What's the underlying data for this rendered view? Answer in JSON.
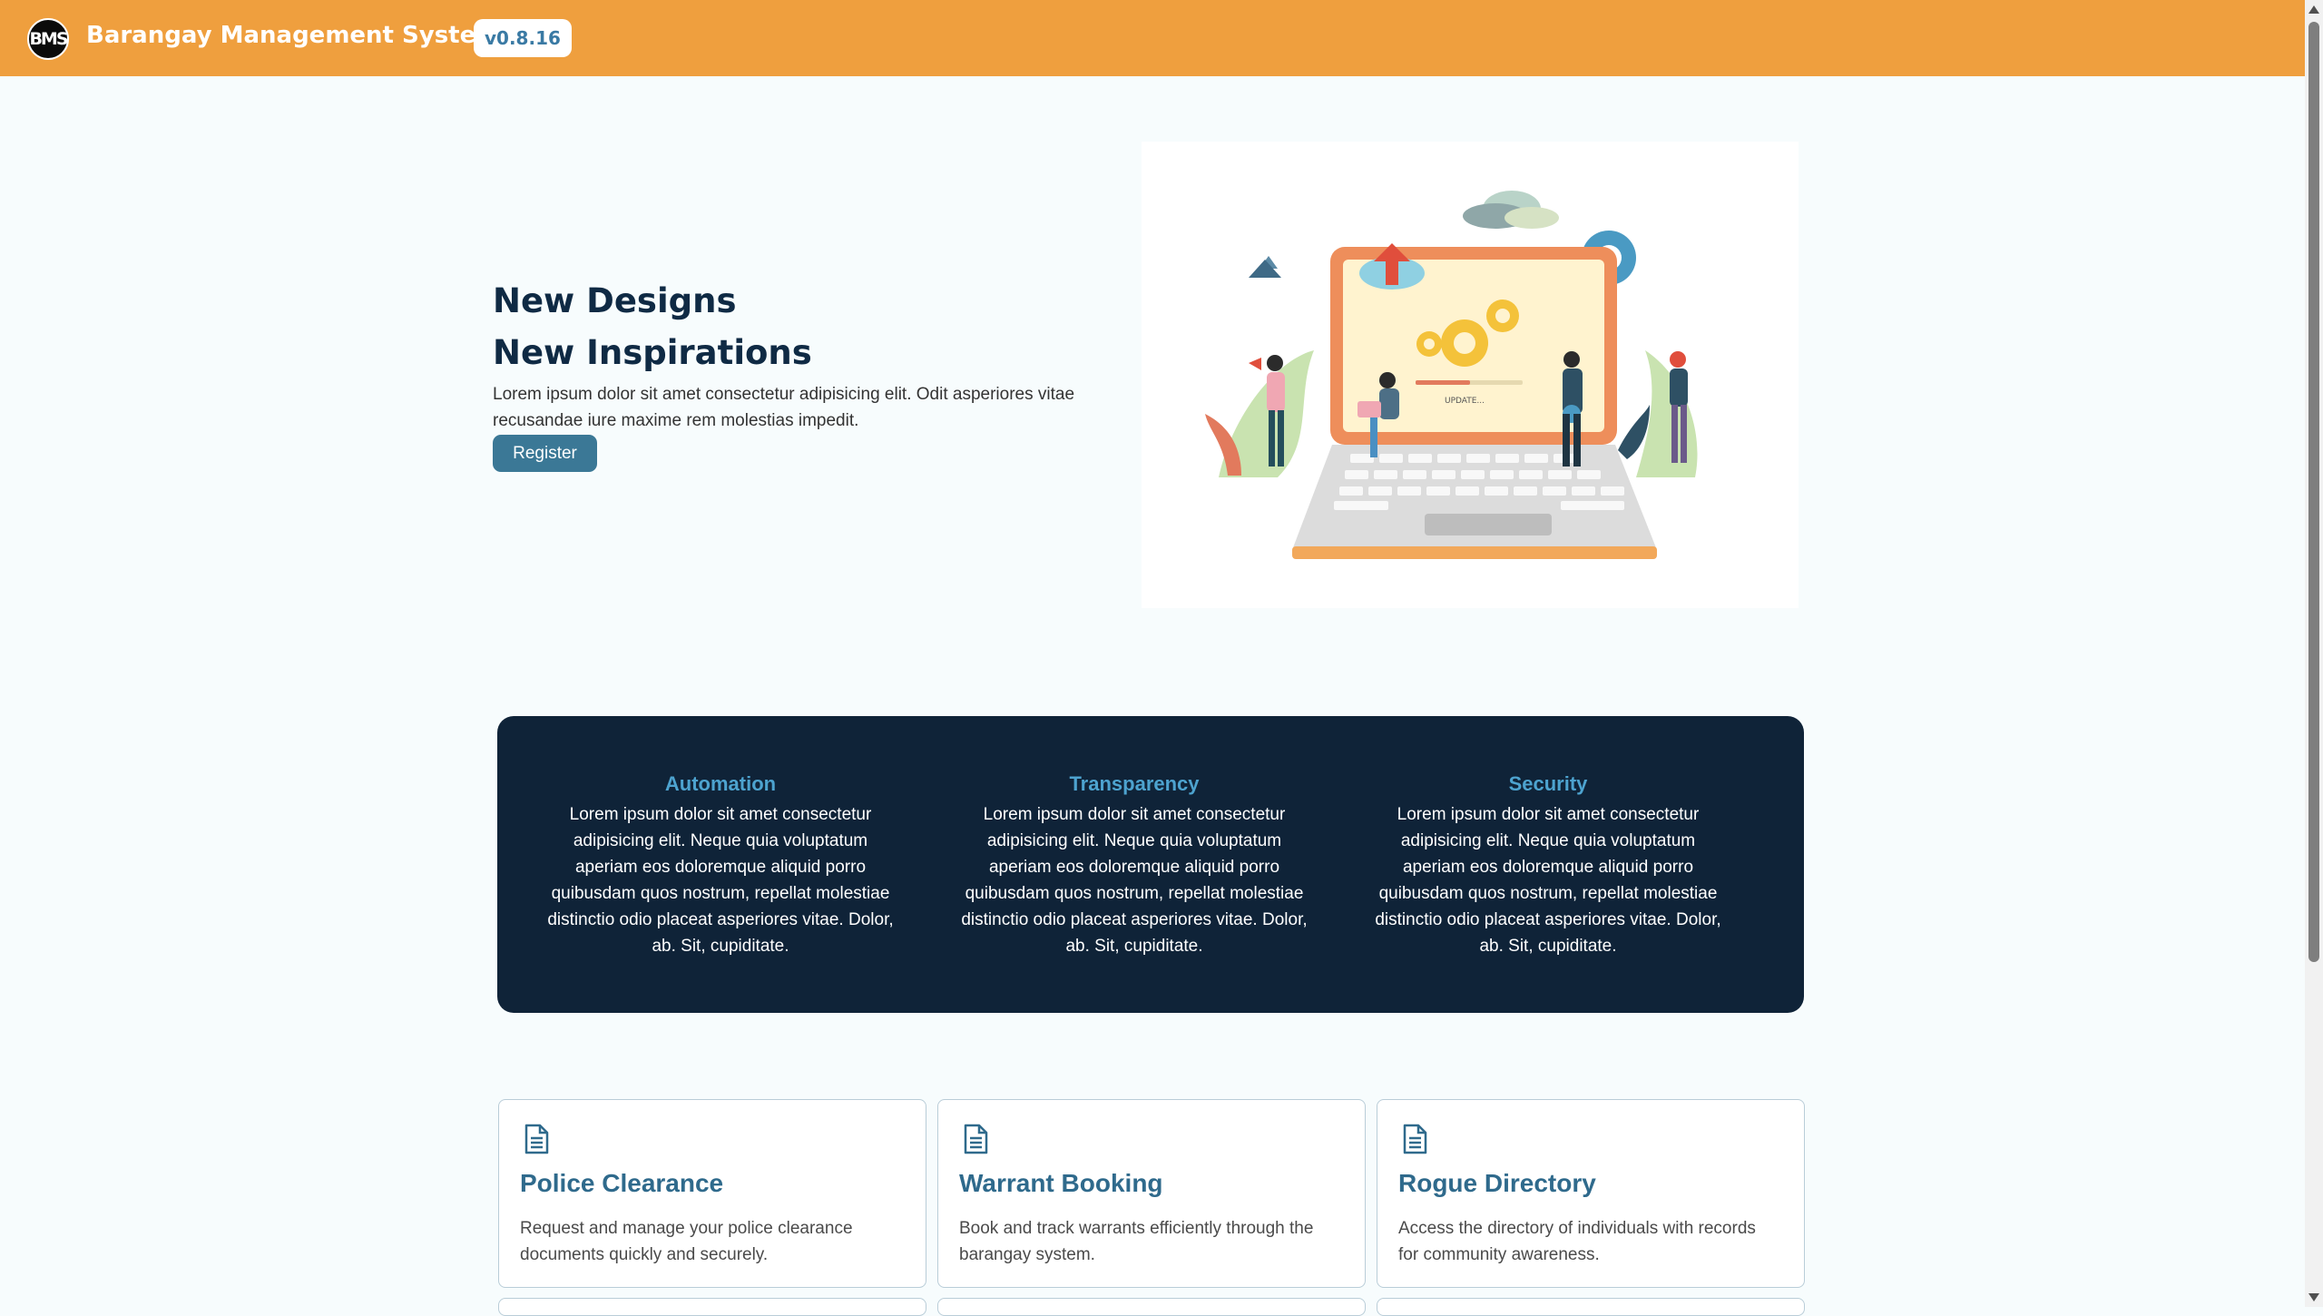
{
  "header": {
    "logo_text": "BMS",
    "app_title": "Barangay Management System App",
    "version": "v0.8.16"
  },
  "hero": {
    "title_line1": "New Designs",
    "title_line2": "New Inspirations",
    "text": "Lorem ipsum dolor sit amet consectetur adipisicing elit. Odit asperiores vitae recusandae iure maxime rem molestias impedit.",
    "register_label": "Register",
    "illustration_text": "UPDATE..."
  },
  "features": [
    {
      "title": "Automation",
      "text": "Lorem ipsum dolor sit amet consectetur adipisicing elit. Neque quia voluptatum aperiam eos doloremque aliquid porro quibusdam quos nostrum, repellat molestiae distinctio odio placeat asperiores vitae. Dolor, ab. Sit, cupiditate."
    },
    {
      "title": "Transparency",
      "text": "Lorem ipsum dolor sit amet consectetur adipisicing elit. Neque quia voluptatum aperiam eos doloremque aliquid porro quibusdam quos nostrum, repellat molestiae distinctio odio placeat asperiores vitae. Dolor, ab. Sit, cupiditate."
    },
    {
      "title": "Security",
      "text": "Lorem ipsum dolor sit amet consectetur adipisicing elit. Neque quia voluptatum aperiam eos doloremque aliquid porro quibusdam quos nostrum, repellat molestiae distinctio odio placeat asperiores vitae. Dolor, ab. Sit, cupiditate."
    }
  ],
  "cards": [
    {
      "icon": "document-icon",
      "title": "Police Clearance",
      "description": "Request and manage your police clearance documents quickly and securely."
    },
    {
      "icon": "document-icon",
      "title": "Warrant Booking",
      "description": "Book and track warrants efficiently through the barangay system."
    },
    {
      "icon": "document-icon",
      "title": "Rogue Directory",
      "description": "Access the directory of individuals with records for community awareness."
    }
  ],
  "colors": {
    "header": "#ef9f3e",
    "features_bg": "#0f2338",
    "accent": "#3b7896",
    "feature_title": "#4da3cf"
  }
}
